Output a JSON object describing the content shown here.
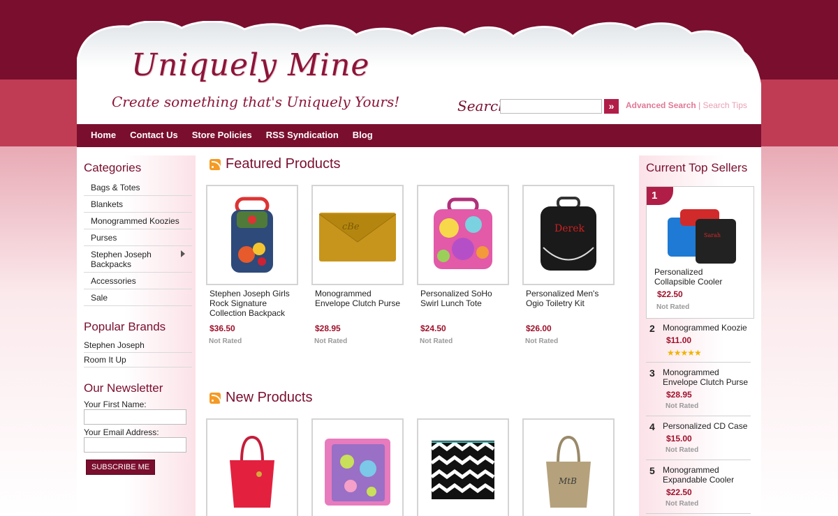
{
  "header": {
    "logo_title": "Uniquely Mine",
    "logo_tagline": "Create something that's Uniquely Yours!",
    "search_label": "Search",
    "search_value": "",
    "search_go": "»",
    "advanced_search": "Advanced Search",
    "separator": "|",
    "search_tips": "Search Tips"
  },
  "nav": [
    "Home",
    "Contact Us",
    "Store Policies",
    "RSS Syndication",
    "Blog"
  ],
  "categories": {
    "heading": "Categories",
    "items": [
      "Bags & Totes",
      "Blankets",
      "Monogrammed Koozies",
      "Purses",
      "Stephen Joseph Backpacks",
      "Accessories",
      "Sale"
    ]
  },
  "brands": {
    "heading": "Popular Brands",
    "items": [
      "Stephen Joseph",
      "Room It Up"
    ]
  },
  "newsletter": {
    "heading": "Our Newsletter",
    "first_name_label": "Your First Name:",
    "email_label": "Your Email Address:",
    "button": "SUBSCRIBE ME"
  },
  "featured": {
    "heading": "Featured Products",
    "products": [
      {
        "name": "Stephen Joseph Girls Rock Signature Collection Backpack",
        "price": "$36.50",
        "rating": "Not Rated"
      },
      {
        "name": "Monogrammed Envelope Clutch Purse",
        "price": "$28.95",
        "rating": "Not Rated"
      },
      {
        "name": "Personalized SoHo Swirl Lunch Tote",
        "price": "$24.50",
        "rating": "Not Rated"
      },
      {
        "name": "Personalized Men's Ogio Toiletry Kit",
        "price": "$26.00",
        "rating": "Not Rated"
      }
    ]
  },
  "new_products": {
    "heading": "New Products"
  },
  "top_sellers": {
    "heading": "Current Top Sellers",
    "items": [
      {
        "rank": "1",
        "name": "Personalized Collapsible Cooler",
        "price": "$22.50",
        "rating": "Not Rated"
      },
      {
        "rank": "2",
        "name": "Monogrammed Koozie",
        "price": "$11.00",
        "stars": "★★★★★"
      },
      {
        "rank": "3",
        "name": "Monogrammed Envelope Clutch Purse",
        "price": "$28.95",
        "rating": "Not Rated"
      },
      {
        "rank": "4",
        "name": "Personalized CD Case",
        "price": "$15.00",
        "rating": "Not Rated"
      },
      {
        "rank": "5",
        "name": "Monogrammed Expandable Cooler",
        "price": "$22.50",
        "rating": "Not Rated"
      }
    ]
  },
  "colors": {
    "brand_dark": "#7a0e2e",
    "brand_mid": "#c03c55",
    "price": "#a0102a",
    "accent": "#b01e48"
  }
}
